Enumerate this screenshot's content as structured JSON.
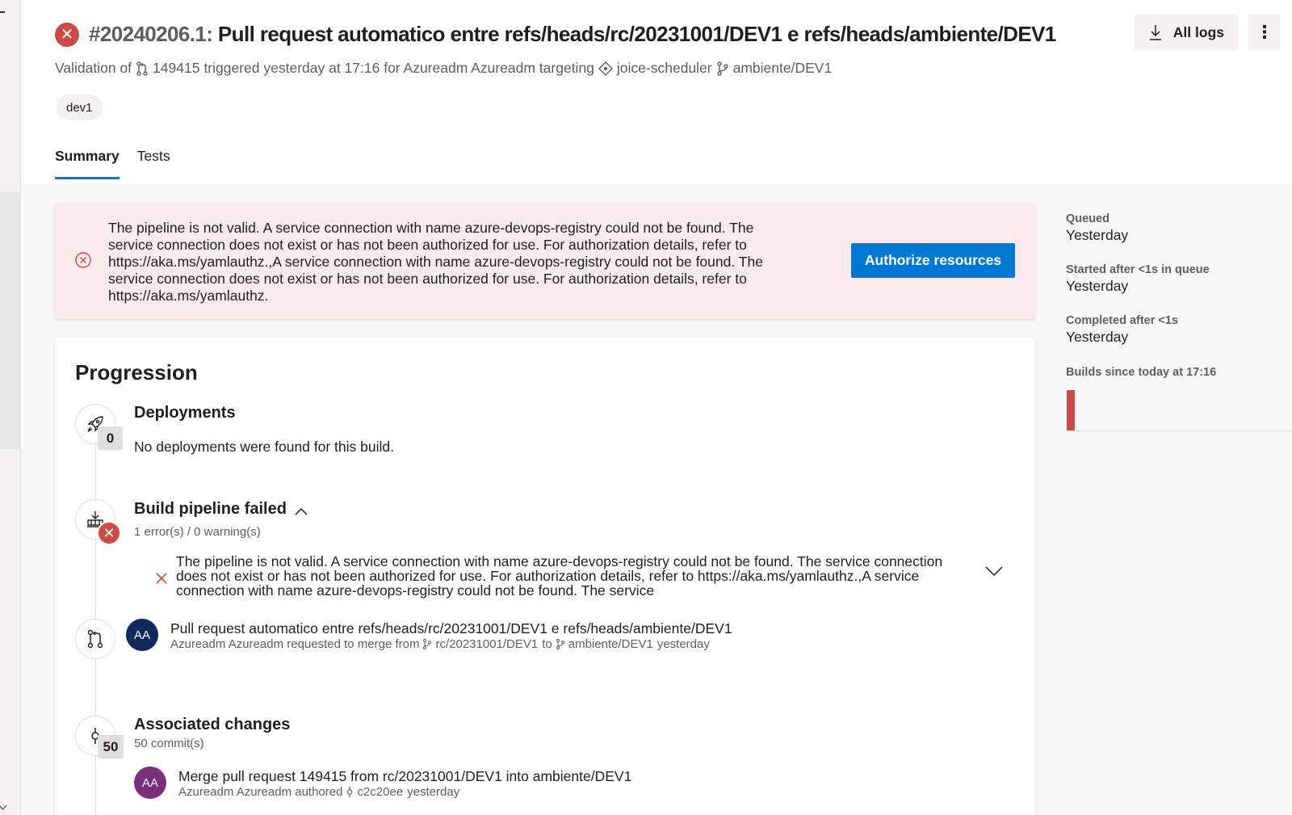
{
  "header": {
    "run_id": "#20240206.1:",
    "title": "Pull request automatico entre refs/heads/rc/20231001/DEV1 e refs/heads/ambiente/DEV1",
    "subtitle_prefix": "Validation of",
    "pr_number": "149415",
    "subtitle_mid": "triggered yesterday at 17:16 for Azureadm Azureadm targeting",
    "repo": "joice-scheduler",
    "branch": "ambiente/DEV1",
    "tag": "dev1",
    "all_logs_label": "All logs",
    "more_label": "⋮"
  },
  "tabs": [
    {
      "label": "Summary",
      "active": true
    },
    {
      "label": "Tests",
      "active": false
    }
  ],
  "error_banner": {
    "message": "The pipeline is not valid. A service connection with name azure-devops-registry could not be found. The service connection does not exist or has not been authorized for use. For authorization details, refer to https://aka.ms/yamlauthz.,A service connection with name azure-devops-registry could not be found. The service connection does not exist or has not been authorized for use. For authorization details, refer to https://aka.ms/yamlauthz.",
    "button_label": "Authorize resources"
  },
  "progression": {
    "title": "Progression",
    "deployments": {
      "title": "Deployments",
      "count": "0",
      "text": "No deployments were found for this build."
    },
    "build": {
      "title": "Build pipeline failed",
      "summary": "1 error(s) / 0 warning(s)",
      "issue": "The pipeline is not valid. A service connection with name azure-devops-registry could not be found. The service connection does not exist or has not been authorized for use. For authorization details, refer to https://aka.ms/yamlauthz.,A service connection with name azure-devops-registry could not be found. The service"
    },
    "pull_request": {
      "avatar": "AA",
      "title": "Pull request automatico entre refs/heads/rc/20231001/DEV1 e refs/heads/ambiente/DEV1",
      "sub_prefix": "Azureadm Azureadm requested to merge from",
      "source": "rc/20231001/DEV1",
      "to": "to",
      "target": "ambiente/DEV1",
      "when": "yesterday"
    },
    "changes": {
      "title": "Associated changes",
      "count": "50",
      "summary": "50 commit(s)",
      "commit": {
        "avatar": "AA",
        "title": "Merge pull request 149415 from rc/20231001/DEV1 into ambiente/DEV1",
        "sub_prefix": "Azureadm Azureadm authored",
        "hash": "c2c20ee",
        "when": "yesterday"
      }
    }
  },
  "meta": {
    "queued_label": "Queued",
    "queued_value": "Yesterday",
    "started_label": "Started after <1s in queue",
    "started_value": "Yesterday",
    "completed_label": "Completed after <1s",
    "completed_value": "Yesterday",
    "builds_label": "Builds since today at 17:16"
  },
  "colors": {
    "accent": "#0078d4",
    "error": "#cd4a45",
    "error_bg": "#f9ebeb",
    "pr_avatar": "#0f2a5a",
    "commit_avatar": "#7a2e7c"
  }
}
